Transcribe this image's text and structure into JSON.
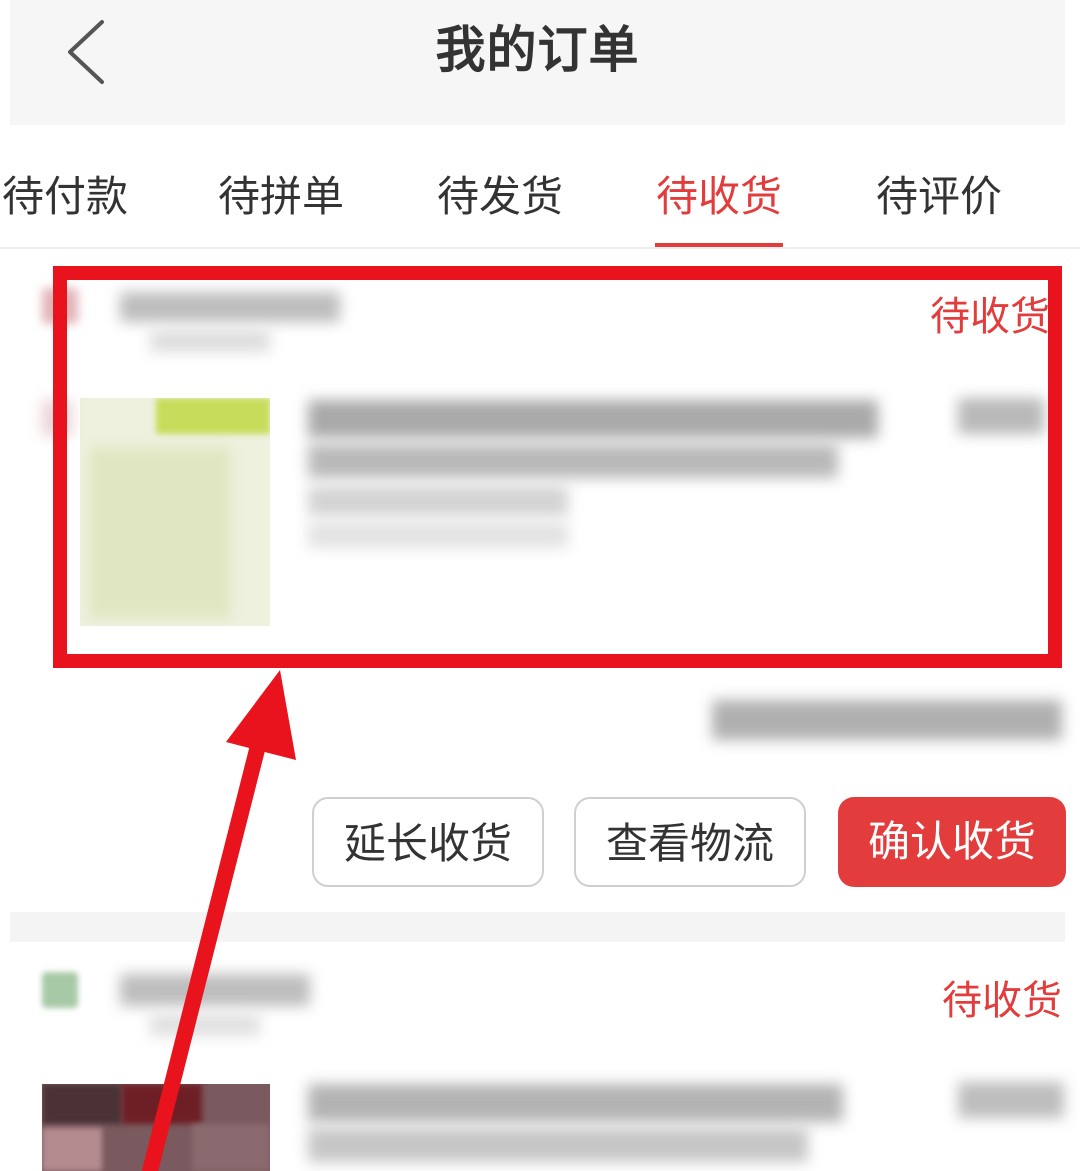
{
  "header": {
    "title": "我的订单",
    "back_icon": "chevron-left-icon"
  },
  "tabs": [
    {
      "label": "待付款",
      "active": false
    },
    {
      "label": "待拼单",
      "active": false
    },
    {
      "label": "待发货",
      "active": false
    },
    {
      "label": "待收货",
      "active": true
    },
    {
      "label": "待评价",
      "active": false
    }
  ],
  "orders": [
    {
      "status": "待收货",
      "actions": {
        "extend_label": "延长收货",
        "logistics_label": "查看物流",
        "confirm_label": "确认收货"
      }
    },
    {
      "status": "待收货"
    }
  ],
  "colors": {
    "accent": "#e23c3c",
    "annotation": "#e8131d"
  }
}
